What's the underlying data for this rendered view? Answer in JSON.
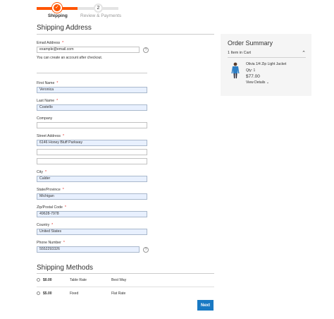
{
  "progress": {
    "steps": [
      {
        "label": "Shipping",
        "marker": "✓"
      },
      {
        "label": "Review & Payments",
        "marker": "2"
      }
    ]
  },
  "shipping_address": {
    "title": "Shipping Address",
    "email_label": "Email Address",
    "email_value": "example@email.com",
    "email_help": "You can create an account after checkout.",
    "fields": {
      "first_name": {
        "label": "First Name",
        "value": "Veronica"
      },
      "last_name": {
        "label": "Last Name",
        "value": "Costello"
      },
      "company": {
        "label": "Company",
        "value": ""
      },
      "street": {
        "label": "Street Address",
        "value": "6146 Honey Bluff Parkway",
        "line2": "",
        "line3": ""
      },
      "city": {
        "label": "City",
        "value": "Calder"
      },
      "region": {
        "label": "State/Province",
        "value": "Michigan"
      },
      "postcode": {
        "label": "Zip/Postal Code",
        "value": "49628-7978"
      },
      "country": {
        "label": "Country",
        "value": "United States"
      },
      "phone": {
        "label": "Phone Number",
        "value": "5552293326"
      }
    },
    "required_marker": "*",
    "help_glyph": "?"
  },
  "order_summary": {
    "title": "Order Summary",
    "items_count": "1 Item in Cart",
    "item": {
      "name": "Olivia 1/4 Zip Light Jacket",
      "qty": "Qty: 1",
      "price": "$77.00",
      "details_link": "View Details"
    }
  },
  "shipping_methods": {
    "title": "Shipping Methods",
    "rows": [
      {
        "price": "$0.00",
        "carrier": "Table Rate",
        "method": "Best Way"
      },
      {
        "price": "$5.00",
        "carrier": "Fixed",
        "method": "Flat Rate"
      }
    ]
  },
  "actions": {
    "next_label": "Next"
  },
  "colors": {
    "accent": "#ff5501",
    "button": "#1979c3",
    "autofill": "#e8f0fe"
  }
}
